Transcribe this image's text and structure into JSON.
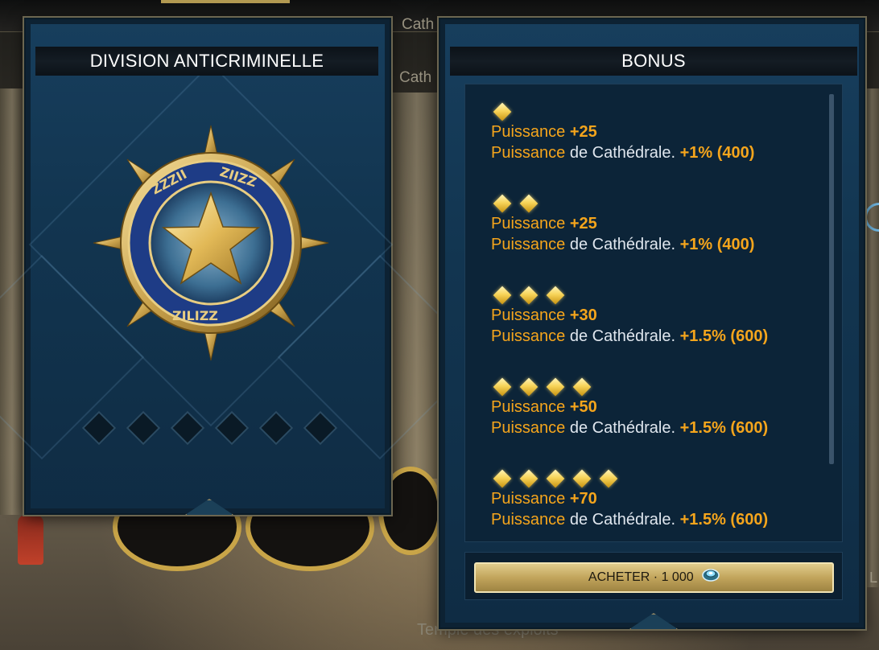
{
  "background": {
    "tab_top": "Cath",
    "tab_second": "Cath",
    "bottom_label": "Temple des exploits",
    "right_edge_label": "L"
  },
  "medal_panel": {
    "title": "DIVISION ANTICRIMINELLE",
    "medal_icon": "police-star-medal-icon",
    "rank_slots_total": 6,
    "rank_slots_filled": 0
  },
  "bonus_panel": {
    "title": "BONUS",
    "tiers": [
      {
        "stars": 1,
        "stat_label": "Puissance",
        "stat_value": "+25",
        "line2_prefix": "Puissance",
        "line2_middle": "de Cathédrale.",
        "line2_value": "+1% (400)"
      },
      {
        "stars": 2,
        "stat_label": "Puissance",
        "stat_value": "+25",
        "line2_prefix": "Puissance",
        "line2_middle": "de Cathédrale.",
        "line2_value": "+1% (400)"
      },
      {
        "stars": 3,
        "stat_label": "Puissance",
        "stat_value": "+30",
        "line2_prefix": "Puissance",
        "line2_middle": "de Cathédrale.",
        "line2_value": "+1.5% (600)"
      },
      {
        "stars": 4,
        "stat_label": "Puissance",
        "stat_value": "+50",
        "line2_prefix": "Puissance",
        "line2_middle": "de Cathédrale.",
        "line2_value": "+1.5% (600)"
      },
      {
        "stars": 5,
        "stat_label": "Puissance",
        "stat_value": "+70",
        "line2_prefix": "Puissance",
        "line2_middle": "de Cathédrale.",
        "line2_value": "+1.5% (600)"
      }
    ],
    "buy_label": "ACHETER · 1 000",
    "currency_icon": "gem-coin-icon"
  },
  "colors": {
    "accent_orange": "#f5a51c",
    "panel_blue": "#123550",
    "gold": "#c2a55c"
  }
}
